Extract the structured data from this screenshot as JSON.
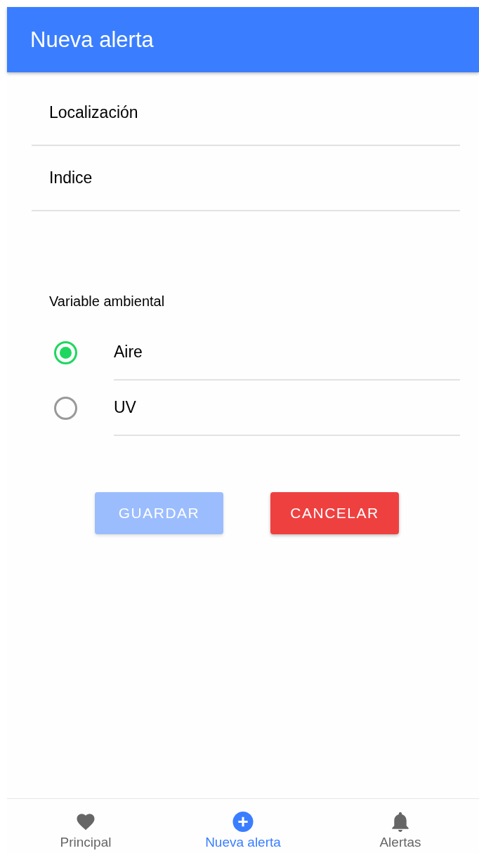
{
  "header": {
    "title": "Nueva alerta"
  },
  "fields": [
    {
      "placeholder": "Localización"
    },
    {
      "placeholder": "Indice"
    }
  ],
  "radio_group": {
    "label": "Variable ambiental",
    "options": [
      {
        "label": "Aire",
        "selected": true
      },
      {
        "label": "UV",
        "selected": false
      }
    ]
  },
  "buttons": [
    {
      "label": "GUARDAR",
      "kind": "primary",
      "disabled": true
    },
    {
      "label": "CANCELAR",
      "kind": "danger",
      "disabled": false
    }
  ],
  "tab_bar": [
    {
      "label": "Principal",
      "kind": "favorites",
      "selected": false
    },
    {
      "label": "Nueva alerta",
      "kind": "add",
      "selected": true
    },
    {
      "label": "Alertas",
      "kind": "alerts",
      "selected": false
    }
  ]
}
